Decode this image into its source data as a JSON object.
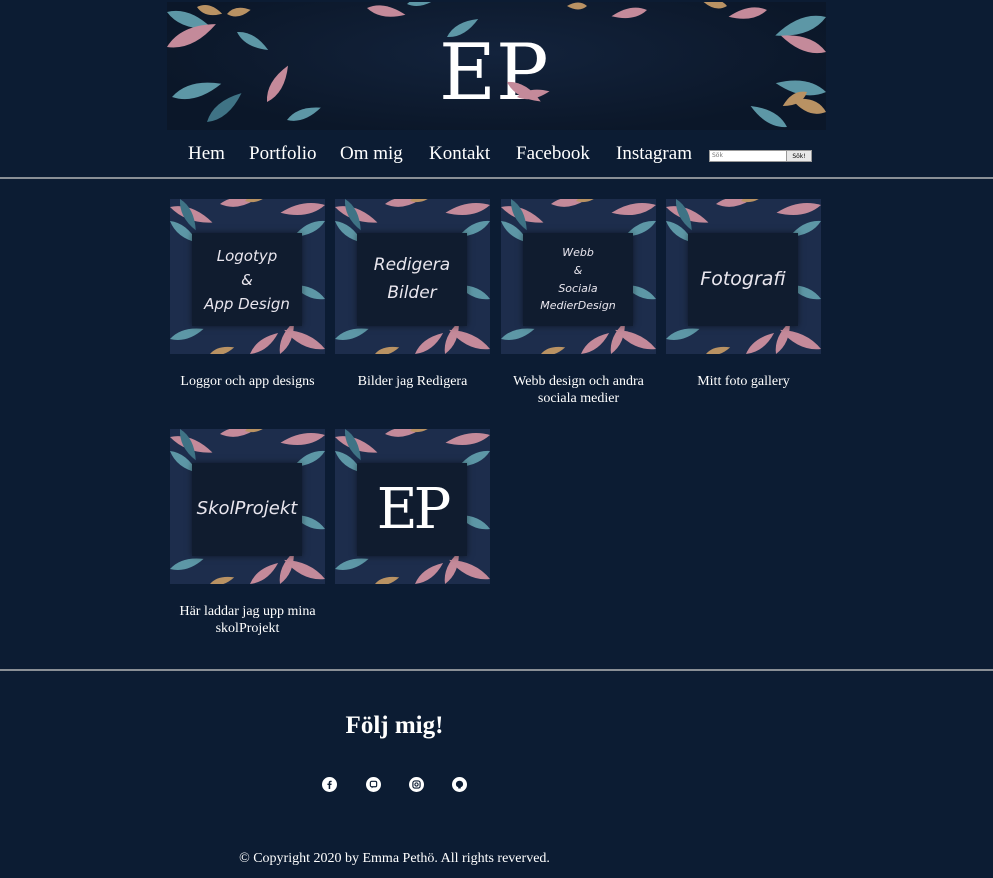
{
  "banner": {
    "logo_text": "EP"
  },
  "nav": {
    "items": [
      "Hem",
      "Portfolio",
      "Om mig",
      "Kontakt",
      "Facebook",
      "Instagram"
    ]
  },
  "search": {
    "placeholder": "Sök",
    "button_label": "Sök!"
  },
  "tiles": [
    {
      "image_text": "Logotyp\n&\nApp Design",
      "caption": "Loggor och app designs"
    },
    {
      "image_text": "Redigera\nBilder",
      "caption": "Bilder jag Redigera"
    },
    {
      "image_text": "Webb\n&\nSociala MedierDesign",
      "caption": "Webb design och andra sociala medier"
    },
    {
      "image_text": "Fotografi",
      "caption": "Mitt foto gallery"
    },
    {
      "image_text": "SkolProjekt",
      "caption": "Här laddar jag upp mina skolProjekt"
    },
    {
      "image_text": "EP",
      "caption": ""
    }
  ],
  "footer": {
    "heading": "Följ mig!",
    "social": [
      "facebook-icon",
      "chat-icon",
      "instagram-icon",
      "github-icon"
    ],
    "copyright": "© Copyright 2020 by Emma Pethö. All rights reverved."
  },
  "colors": {
    "background": "#0c1c33",
    "tile": "#1d2d4c",
    "leaf_pink": "#c48a9a",
    "leaf_teal": "#5d97a6",
    "leaf_gold": "#b99263"
  }
}
